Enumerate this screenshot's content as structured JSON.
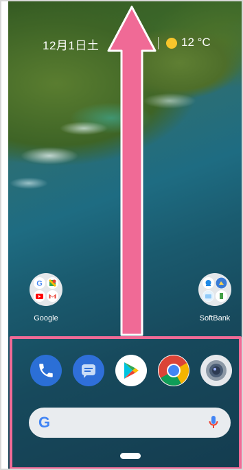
{
  "status": {
    "date": "12月1日土",
    "temperature": "12 °C",
    "weather_icon": "sun-icon"
  },
  "folders": [
    {
      "label": "Google",
      "icon": "google-folder-icon"
    },
    {
      "label": "SoftBank",
      "icon": "softbank-folder-icon"
    }
  ],
  "dock": {
    "apps": [
      {
        "name": "phone-app-icon"
      },
      {
        "name": "messages-app-icon"
      },
      {
        "name": "play-store-app-icon"
      },
      {
        "name": "chrome-app-icon"
      },
      {
        "name": "camera-app-icon"
      }
    ]
  },
  "search": {
    "logo": "G",
    "mic_icon": "mic-icon"
  },
  "colors": {
    "highlight": "#f06a96",
    "arrow": "#f06a96",
    "search_bg": "#e9ecef",
    "phone": "#2b6fd6",
    "messages": "#2f6fd9",
    "chrome_red": "#db4437",
    "chrome_yellow": "#f4b400",
    "chrome_green": "#0f9d58",
    "chrome_blue": "#4285f4"
  }
}
